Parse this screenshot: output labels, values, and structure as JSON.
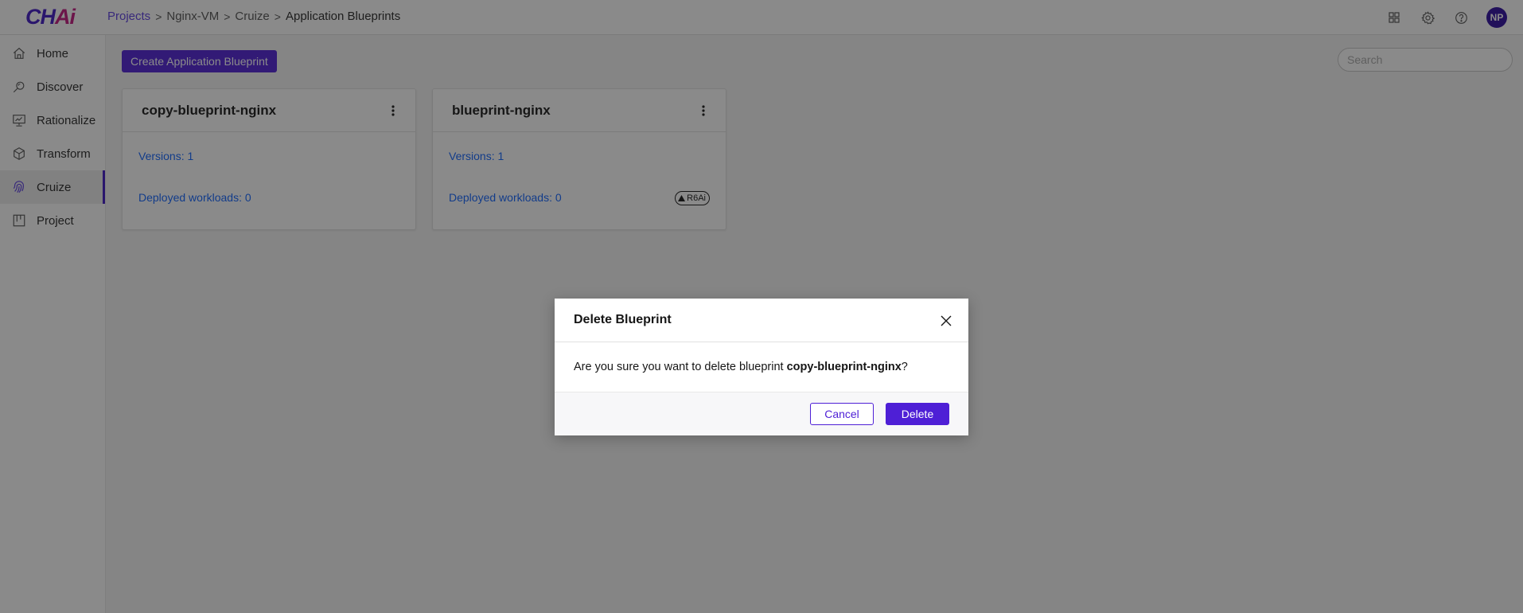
{
  "app": {
    "logo_main": "CH",
    "logo_accent": "Ai"
  },
  "breadcrumb": {
    "items": [
      "Projects",
      "Nginx-VM",
      "Cruize"
    ],
    "current": "Application Blueprints"
  },
  "header": {
    "icons": [
      "apps-grid-icon",
      "gear-icon",
      "help-icon"
    ],
    "avatar_initials": "NP"
  },
  "sidebar": {
    "items": [
      {
        "label": "Home",
        "icon": "home-icon",
        "active": false
      },
      {
        "label": "Discover",
        "icon": "discover-icon",
        "active": false
      },
      {
        "label": "Rationalize",
        "icon": "rationalize-icon",
        "active": false
      },
      {
        "label": "Transform",
        "icon": "cube-icon",
        "active": false
      },
      {
        "label": "Cruize",
        "icon": "fingerprint-icon",
        "active": true
      },
      {
        "label": "Project",
        "icon": "project-icon",
        "active": false
      }
    ]
  },
  "toolbar": {
    "create_label": "Create Application Blueprint",
    "search_placeholder": "Search"
  },
  "cards": [
    {
      "title": "copy-blueprint-nginx",
      "versions": "Versions: 1",
      "deployed": "Deployed workloads: 0",
      "badge": ""
    },
    {
      "title": "blueprint-nginx",
      "versions": "Versions: 1",
      "deployed": "Deployed workloads: 0",
      "badge": "R6Ai"
    }
  ],
  "modal": {
    "title": "Delete Blueprint",
    "body_prefix": "Are you sure you want to delete blueprint ",
    "body_target": "copy-blueprint-nginx",
    "body_suffix": "?",
    "cancel_label": "Cancel",
    "delete_label": "Delete"
  },
  "colors": {
    "accent": "#4e1fd6",
    "link": "#0f62fe",
    "logo_accent": "#c2157f"
  }
}
